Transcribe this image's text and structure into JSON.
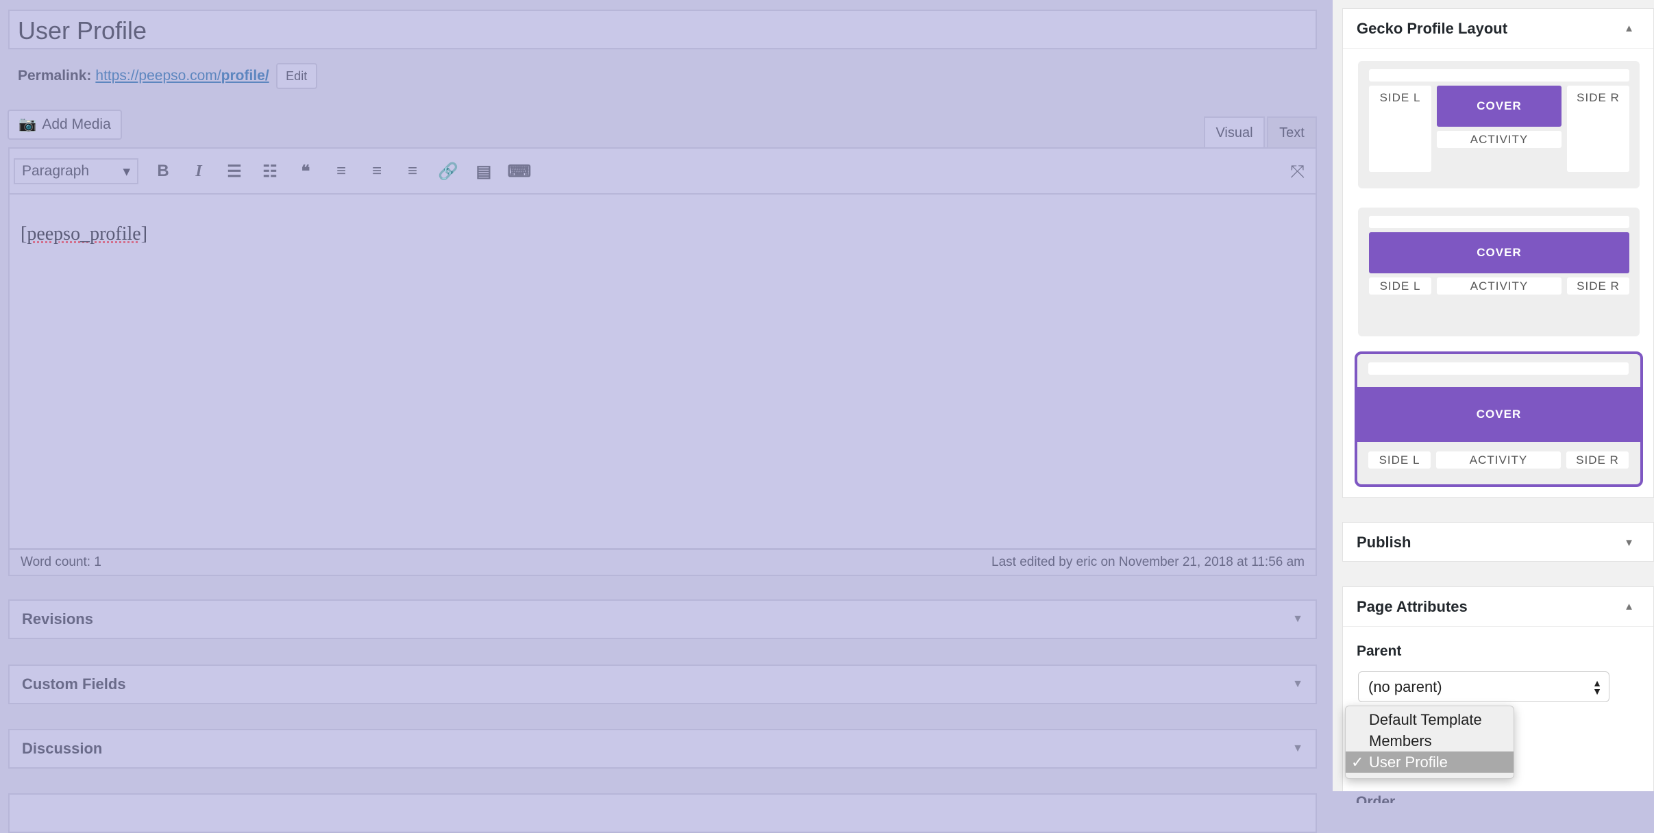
{
  "editor": {
    "title": "User Profile",
    "permalink_label": "Permalink:",
    "permalink_base": "https://peepso.com/",
    "permalink_slug": "profile/",
    "edit_label": "Edit",
    "add_media_label": "Add Media",
    "tabs": [
      {
        "label": "Visual",
        "active": true
      },
      {
        "label": "Text",
        "active": false
      }
    ],
    "format_select": "Paragraph",
    "toolbar_icons": [
      "bold-icon",
      "italic-icon",
      "bullet-list-icon",
      "numbered-list-icon",
      "blockquote-icon",
      "align-left-icon",
      "align-center-icon",
      "align-right-icon",
      "link-icon",
      "read-more-icon",
      "toolbar-toggle-icon",
      "fullscreen-icon"
    ],
    "content": "[peepso_profile]",
    "word_count": "Word count: 1",
    "last_edited": "Last edited by eric on November 21, 2018 at 11:56 am"
  },
  "panels": [
    {
      "label": "Revisions"
    },
    {
      "label": "Custom Fields"
    },
    {
      "label": "Discussion"
    }
  ],
  "sidebar": {
    "gecko": {
      "title": "Gecko Profile Layout",
      "labels": {
        "side_l": "SIDE L",
        "side_r": "SIDE R",
        "cover": "COVER",
        "activity": "ACTIVITY"
      },
      "selected_layout": 3
    },
    "publish": {
      "title": "Publish"
    },
    "page_attributes": {
      "title": "Page Attributes",
      "parent_label": "Parent",
      "parent_value": "(no parent)",
      "template_options": [
        {
          "label": "Default Template"
        },
        {
          "label": "Members"
        },
        {
          "label": "User Profile",
          "selected": true
        }
      ],
      "order_label": "Order"
    }
  },
  "colors": {
    "accent": "#7e57c2",
    "overlay": "#c3c2e2"
  }
}
